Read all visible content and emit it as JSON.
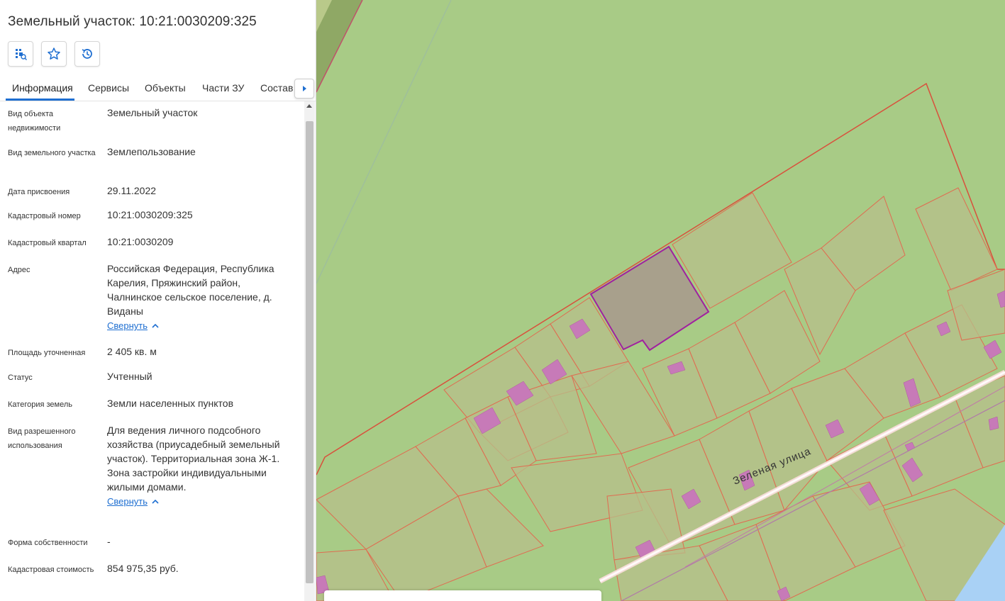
{
  "panel": {
    "title": "Земельный участок: 10:21:0030209:325",
    "actions": [
      {
        "icon": "select-area-icon"
      },
      {
        "icon": "star-icon"
      },
      {
        "icon": "history-icon"
      }
    ],
    "tabs": [
      "Информация",
      "Сервисы",
      "Объекты",
      "Части ЗУ",
      "Состав"
    ],
    "active_tab": "Информация",
    "collapse_label": "Свернуть",
    "rows": [
      {
        "label": "Вид объекта недвижимости",
        "value": "Земельный участок"
      },
      {
        "label": "Вид земельного участка",
        "value": "Землепользование"
      },
      {
        "label": "Дата присвоения",
        "value": "29.11.2022"
      },
      {
        "label": "Кадастровый номер",
        "value": "10:21:0030209:325"
      },
      {
        "label": "Кадастровый квартал",
        "value": "10:21:0030209"
      },
      {
        "label": "Адрес",
        "value": "Российская Федерация, Республика Карелия, Пряжинский район, Чалнинское сельское поселение, д. Виданы"
      },
      {
        "label": "Площадь уточненная",
        "value": "2 405 кв. м"
      },
      {
        "label": "Статус",
        "value": "Учтенный"
      },
      {
        "label": "Категория земель",
        "value": "Земли населенных пунктов"
      },
      {
        "label": "Вид разрешенного использования",
        "value": "Для ведения личного подсобного хозяйства (приусадебный земельный участок). Территориальная зона Ж-1. Зона застройки индивидуальными жилыми домами."
      },
      {
        "label": "Форма собственности",
        "value": "-"
      },
      {
        "label": "Кадастровая стоимость",
        "value": "854 975,35 руб."
      }
    ]
  },
  "map": {
    "street_label": "Зеленая улица",
    "colors": {
      "background": "#a8cb86",
      "parcel_fill": "#b7bf8a",
      "parcel_stroke": "#e06b50",
      "selected_fill": "#a8a08c",
      "selected_stroke": "#a020a0",
      "building": "#c77ab8",
      "water": "#a9d1f5"
    }
  }
}
